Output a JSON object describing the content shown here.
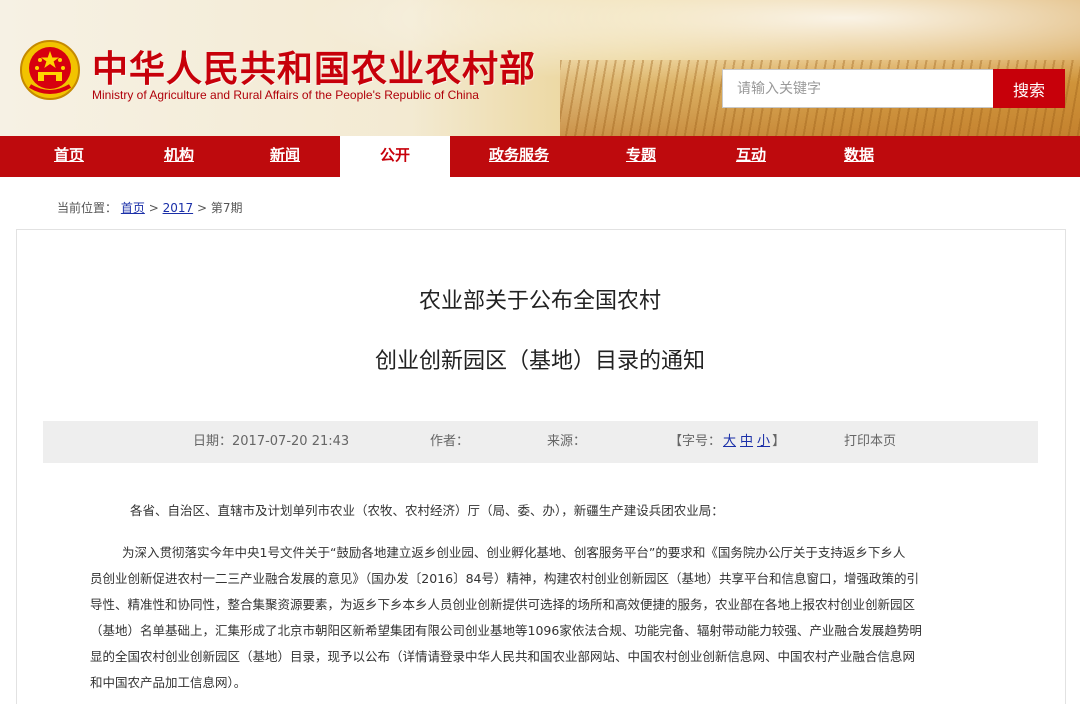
{
  "header": {
    "site_title": "中华人民共和国农业农村部",
    "site_subtitle": "Ministry of Agriculture and Rural Affairs of the People's Republic of China",
    "search_placeholder": "请输入关键字",
    "search_button": "搜索",
    "emblem_icon": "national-emblem-icon"
  },
  "nav": {
    "items": [
      {
        "label": "首页"
      },
      {
        "label": "机构"
      },
      {
        "label": "新闻"
      },
      {
        "label": "公开",
        "active": true
      },
      {
        "label": "政务服务"
      },
      {
        "label": "专题"
      },
      {
        "label": "互动"
      },
      {
        "label": "数据"
      }
    ]
  },
  "breadcrumb": {
    "prefix": "当前位置：",
    "items": [
      "首页",
      "2017",
      "第7期"
    ],
    "separator": ">"
  },
  "article": {
    "title_line1": "农业部关于公布全国农村",
    "title_line2": "创业创新园区（基地）目录的通知",
    "meta": {
      "date_label": "日期：",
      "date_value": "2017-07-20 21:43",
      "author_label": "作者：",
      "source_label": "来源：",
      "fontsize_prefix": "【字号：",
      "font_large": "大",
      "font_medium": "中",
      "font_small": "小",
      "fontsize_suffix": "】",
      "print_label": "打印本页"
    },
    "salutation": "各省、自治区、直辖市及计划单列市农业（农牧、农村经济）厅（局、委、办），新疆生产建设兵团农业局：",
    "body_lines": [
      "为深入贯彻落实今年中央1号文件关于“鼓励各地建立返乡创业园、创业孵化基地、创客服务平台”的要求和《国务院办公厅关于支持返乡下乡人",
      "员创业创新促进农村一二三产业融合发展的意见》（国办发〔2016〕84号）精神，构建农村创业创新园区（基地）共享平台和信息窗口，增强政策的引",
      "导性、精准性和协同性，整合集聚资源要素，为返乡下乡本乡人员创业创新提供可选择的场所和高效便捷的服务，农业部在各地上报农村创业创新园区",
      "（基地）名单基础上，汇集形成了北京市朝阳区新希望集团有限公司创业基地等1096家依法合规、功能完备、辐射带动能力较强、产业融合发展趋势明",
      "显的全国农村创业创新园区（基地）目录，现予以公布（详情请登录中华人民共和国农业部网站、中国农村创业创新信息网、中国农村产业融合信息网",
      "和中国农产品加工信息网）。"
    ]
  },
  "colors": {
    "brand_red": "#c7000a",
    "nav_red": "#be0a0d",
    "link_blue": "#1a2fa8",
    "meta_bg": "#eeeeee"
  }
}
